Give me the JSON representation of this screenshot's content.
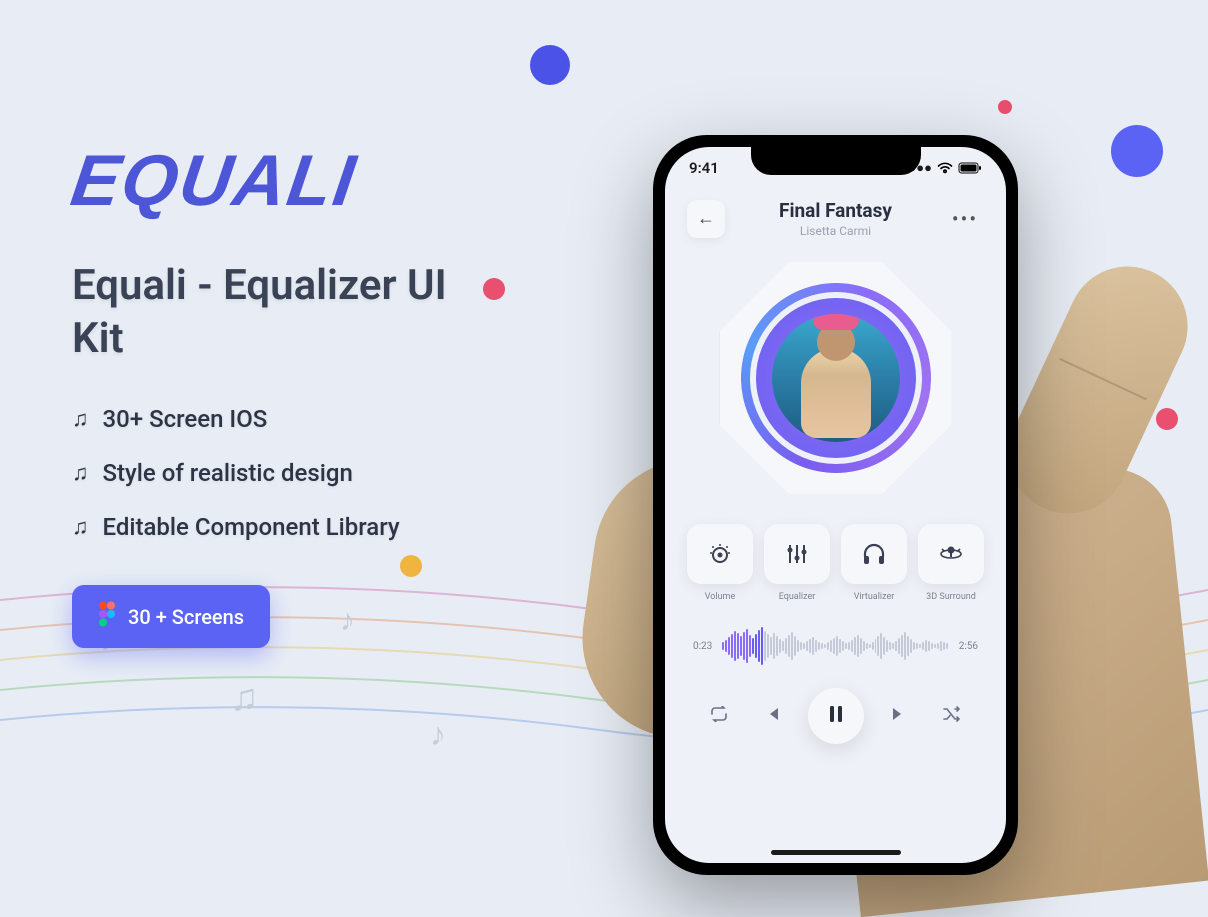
{
  "brand": "Equali",
  "title": "Equali - Equalizer UI Kit",
  "features": [
    "30+ Screen IOS",
    "Style of realistic design",
    "Editable Component Library"
  ],
  "cta_label": "30 + Screens",
  "phone": {
    "status_time": "9:41",
    "track_title": "Final Fantasy",
    "artist": "Lisetta Carmi",
    "controls": [
      {
        "label": "Volume",
        "icon": "volume"
      },
      {
        "label": "Equalizer",
        "icon": "equalizer"
      },
      {
        "label": "Virtualizer",
        "icon": "headphones"
      },
      {
        "label": "3D Surround",
        "icon": "surround"
      }
    ],
    "time_current": "0:23",
    "time_total": "2:56"
  }
}
